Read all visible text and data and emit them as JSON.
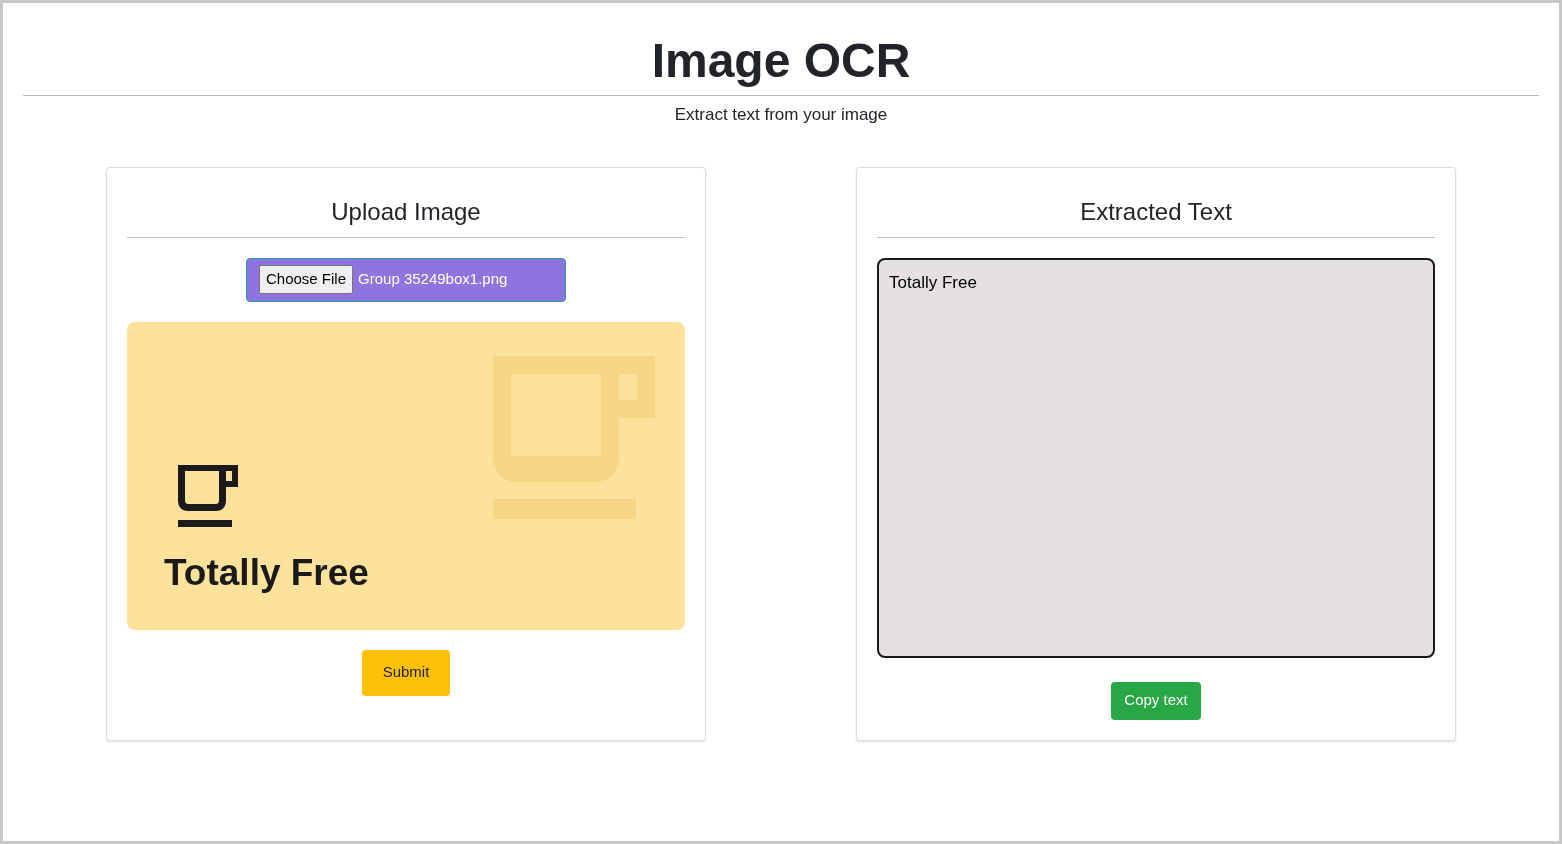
{
  "header": {
    "title": "Image OCR",
    "subtitle": "Extract text from your image"
  },
  "upload_card": {
    "title": "Upload Image",
    "file_input": {
      "button": "Choose File",
      "file_name": "Group 35249box1.png"
    },
    "preview_image": {
      "caption": "Totally Free"
    },
    "submit_button": "Submit"
  },
  "result_card": {
    "title": "Extracted Text",
    "text_area": {
      "value": "Totally Free"
    },
    "copy_button": "Copy text"
  }
}
